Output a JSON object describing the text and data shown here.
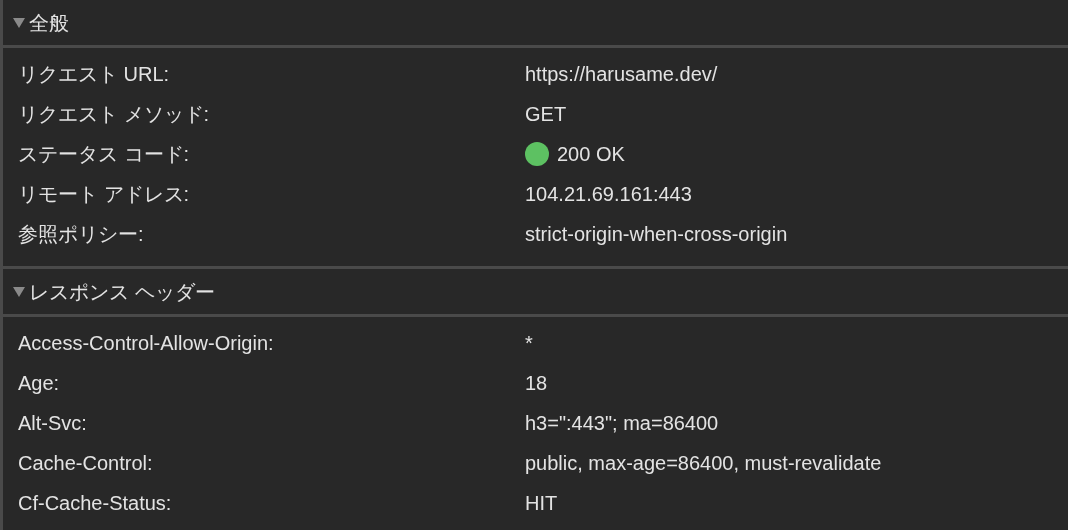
{
  "sections": [
    {
      "title": "全般",
      "expanded": true,
      "rows": [
        {
          "name": "リクエスト URL:",
          "value": "https://harusame.dev/"
        },
        {
          "name": "リクエスト メソッド:",
          "value": "GET"
        },
        {
          "name": "ステータス コード:",
          "value": "200 OK",
          "color": "#5dc162"
        },
        {
          "name": "リモート アドレス:",
          "value": "104.21.69.161:443"
        },
        {
          "name": "参照ポリシー:",
          "value": "strict-origin-when-cross-origin"
        }
      ]
    },
    {
      "title": "レスポンス ヘッダー",
      "expanded": true,
      "rows": [
        {
          "name": "Access-Control-Allow-Origin:",
          "value": "*"
        },
        {
          "name": "Age:",
          "value": "18"
        },
        {
          "name": "Alt-Svc:",
          "value": "h3=\":443\"; ma=86400"
        },
        {
          "name": "Cache-Control:",
          "value": "public, max-age=86400, must-revalidate"
        },
        {
          "name": "Cf-Cache-Status:",
          "value": "HIT"
        }
      ]
    }
  ]
}
